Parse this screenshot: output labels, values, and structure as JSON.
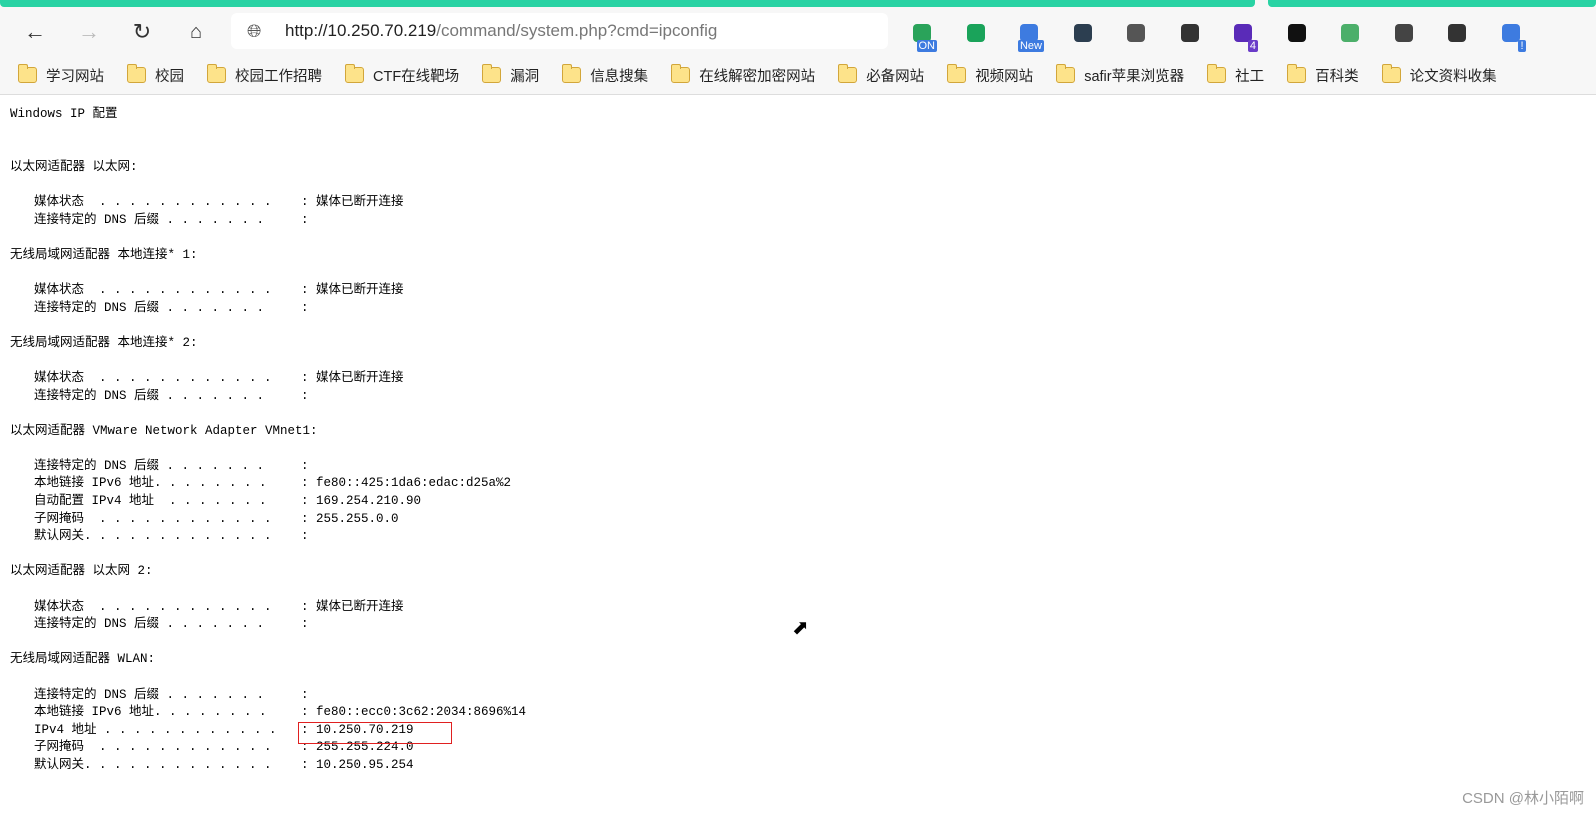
{
  "browser": {
    "url_host": "http://10.250.70.219",
    "url_path": "/command/system.php?cmd=ipconfig",
    "bookmarks": [
      "学习网站",
      "校园",
      "校园工作招聘",
      "CTF在线靶场",
      "漏洞",
      "信息搜集",
      "在线解密加密网站",
      "必备网站",
      "视频网站",
      "safir苹果浏览器",
      "社工",
      "百科类",
      "论文资料收集"
    ],
    "extensions": [
      {
        "icon": "info-on-icon",
        "badge": "ON",
        "color": "#2aa35a"
      },
      {
        "icon": "green-chat-icon",
        "badge": "",
        "color": "#1aa35a"
      },
      {
        "icon": "new-extension-icon",
        "badge": "New",
        "color": "#3d7be0"
      },
      {
        "icon": "sync-circle-icon",
        "badge": "",
        "color": "#2c3e50"
      },
      {
        "icon": "copy-icon",
        "badge": "",
        "color": "#555"
      },
      {
        "icon": "paragraph-arrow-icon",
        "badge": "",
        "color": "#333"
      },
      {
        "icon": "purple-diamond-icon",
        "badge": "4",
        "color": "#5a2bb8"
      },
      {
        "icon": "tampermonkey-icon",
        "badge": "",
        "color": "#111"
      },
      {
        "icon": "adguard-shield-icon",
        "badge": "",
        "color": "#4caf6a"
      },
      {
        "icon": "play-icon",
        "badge": "",
        "color": "#444"
      },
      {
        "icon": "translate-icon",
        "badge": "",
        "color": "#333"
      },
      {
        "icon": "bird-alert-icon",
        "badge": "!",
        "color": "#3d7be0"
      }
    ]
  },
  "output": {
    "title": "Windows IP 配置",
    "sections": [
      {
        "header": "以太网适配器 以太网:",
        "entries": [
          {
            "label": "媒体状态  . . . . . . . . . . . .",
            "value": ": 媒体已断开连接"
          },
          {
            "label": "连接特定的 DNS 后缀 . . . . . . .",
            "value": ":"
          }
        ]
      },
      {
        "header": "无线局域网适配器 本地连接* 1:",
        "entries": [
          {
            "label": "媒体状态  . . . . . . . . . . . .",
            "value": ": 媒体已断开连接"
          },
          {
            "label": "连接特定的 DNS 后缀 . . . . . . .",
            "value": ":"
          }
        ]
      },
      {
        "header": "无线局域网适配器 本地连接* 2:",
        "entries": [
          {
            "label": "媒体状态  . . . . . . . . . . . .",
            "value": ": 媒体已断开连接"
          },
          {
            "label": "连接特定的 DNS 后缀 . . . . . . .",
            "value": ":"
          }
        ]
      },
      {
        "header": "以太网适配器 VMware Network Adapter VMnet1:",
        "entries": [
          {
            "label": "连接特定的 DNS 后缀 . . . . . . .",
            "value": ":"
          },
          {
            "label": "本地链接 IPv6 地址. . . . . . . .",
            "value": ": fe80::425:1da6:edac:d25a%2"
          },
          {
            "label": "自动配置 IPv4 地址  . . . . . . .",
            "value": ": 169.254.210.90"
          },
          {
            "label": "子网掩码  . . . . . . . . . . . .",
            "value": ": 255.255.0.0"
          },
          {
            "label": "默认网关. . . . . . . . . . . . .",
            "value": ":"
          }
        ]
      },
      {
        "header": "以太网适配器 以太网 2:",
        "entries": [
          {
            "label": "媒体状态  . . . . . . . . . . . .",
            "value": ": 媒体已断开连接"
          },
          {
            "label": "连接特定的 DNS 后缀 . . . . . . .",
            "value": ":"
          }
        ]
      },
      {
        "header": "无线局域网适配器 WLAN:",
        "entries": [
          {
            "label": "连接特定的 DNS 后缀 . . . . . . .",
            "value": ":"
          },
          {
            "label": "本地链接 IPv6 地址. . . . . . . .",
            "value": ": fe80::ecc0:3c62:2034:8696%14"
          },
          {
            "label": "IPv4 地址 . . . . . . . . . . . .",
            "value": ": 10.250.70.219"
          },
          {
            "label": "子网掩码  . . . . . . . . . . . .",
            "value": ": 255.255.224.0"
          },
          {
            "label": "默认网关. . . . . . . . . . . . .",
            "value": ": 10.250.95.254"
          }
        ]
      }
    ]
  },
  "watermark": "CSDN @林小陌啊"
}
